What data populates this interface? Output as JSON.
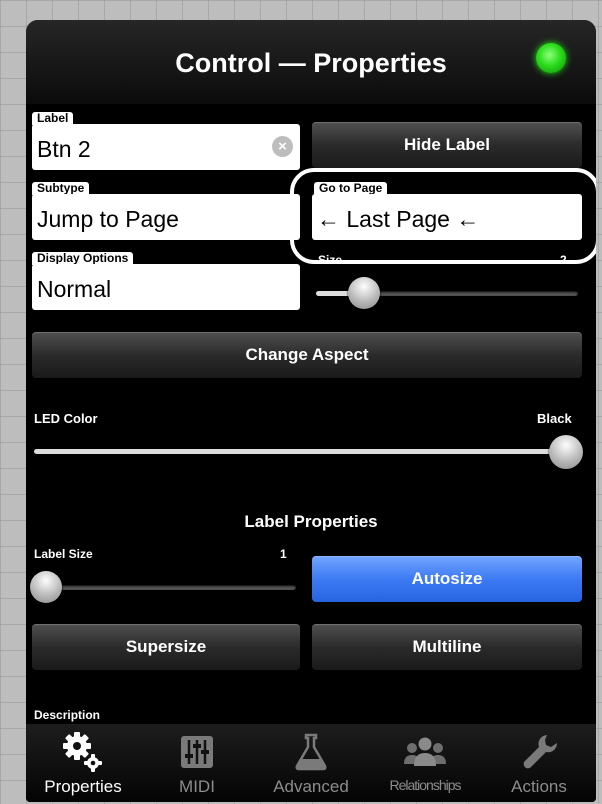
{
  "header": {
    "title": "Control — Properties",
    "status_led_color": "#2bdc1c"
  },
  "label": {
    "caption": "Label",
    "value": "Btn 2"
  },
  "hide_label_button": "Hide Label",
  "subtype": {
    "caption": "Subtype",
    "value": "Jump to Page"
  },
  "go_to_page": {
    "caption": "Go to Page",
    "value": "← Last Page ←"
  },
  "display_options": {
    "caption": "Display Options",
    "value": "Normal"
  },
  "size": {
    "caption": "Size",
    "value": "2"
  },
  "change_aspect_button": "Change Aspect",
  "led_color": {
    "caption": "LED Color",
    "value": "Black"
  },
  "label_properties": {
    "heading": "Label Properties",
    "size_caption": "Label Size",
    "size_value": "1"
  },
  "autosize_button": "Autosize",
  "supersize_button": "Supersize",
  "multiline_button": "Multiline",
  "description_caption": "Description",
  "tabs": [
    {
      "label": "Properties",
      "icon": "gears-icon",
      "active": true
    },
    {
      "label": "MIDI",
      "icon": "mixer-sliders-icon",
      "active": false
    },
    {
      "label": "Advanced",
      "icon": "flask-icon",
      "active": false
    },
    {
      "label": "Relationships",
      "icon": "people-icon",
      "active": false
    },
    {
      "label": "Actions",
      "icon": "wrench-icon",
      "active": false
    }
  ]
}
